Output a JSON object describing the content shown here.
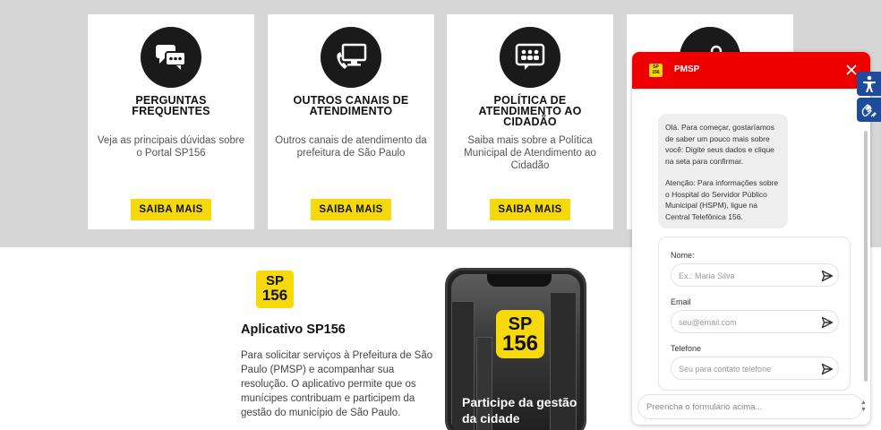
{
  "cards": [
    {
      "title": "PERGUNTAS FREQUENTES",
      "description": "Veja as principais dúvidas sobre o Portal SP156",
      "button": "SAIBA MAIS",
      "icon": "chat-bubbles-icon"
    },
    {
      "title": "OUTROS CANAIS DE ATENDIMENTO",
      "description": "Outros canais de atendimento da prefeitura de São Paulo",
      "button": "SAIBA MAIS",
      "icon": "phone-monitor-icon"
    },
    {
      "title": "POLÍTICA DE ATENDIMENTO AO CIDADÃO",
      "description": "Saiba mais sobre a Política Municipal de Atendimento ao Cidadão",
      "button": "SAIBA MAIS",
      "icon": "group-icon"
    }
  ],
  "app": {
    "logo_line1": "SP",
    "logo_line2": "156",
    "title": "Aplicativo SP156",
    "description": "Para solicitar serviços à Prefeitura de São Paulo (PMSP) e acompanhar sua resolução. O aplicativo permite que os munícipes contribuam e participem da gestão do município de São Paulo.",
    "phone_logo_line1": "SP",
    "phone_logo_line2": "156",
    "phone_tagline": "Participe da gestão da cidade"
  },
  "chat": {
    "header_name": "PMSP",
    "logo_line1": "SP",
    "logo_line2": "156",
    "message_p1": "Olá. Para começar, gostaríamos de saber um pouco mais sobre você: Digite seus dados e clique na seta para confirmar.",
    "message_p2": "Atenção: Para informações sobre o Hospital do Servidor Público Municipal (HSPM), ligue na Central Telefônica 156.",
    "fields": [
      {
        "label": "Nome:",
        "placeholder": "Ex.: Maria Silva"
      },
      {
        "label": "Email",
        "placeholder": "seu@email.com"
      },
      {
        "label": "Telefone",
        "placeholder": "Seu para contato telefone"
      }
    ],
    "footer_placeholder": "Preencha o formulário acima..."
  },
  "colors": {
    "accent_yellow": "#f5d90a",
    "chat_header_red": "#ee0000",
    "accessibility_blue": "#1e4b9c"
  }
}
